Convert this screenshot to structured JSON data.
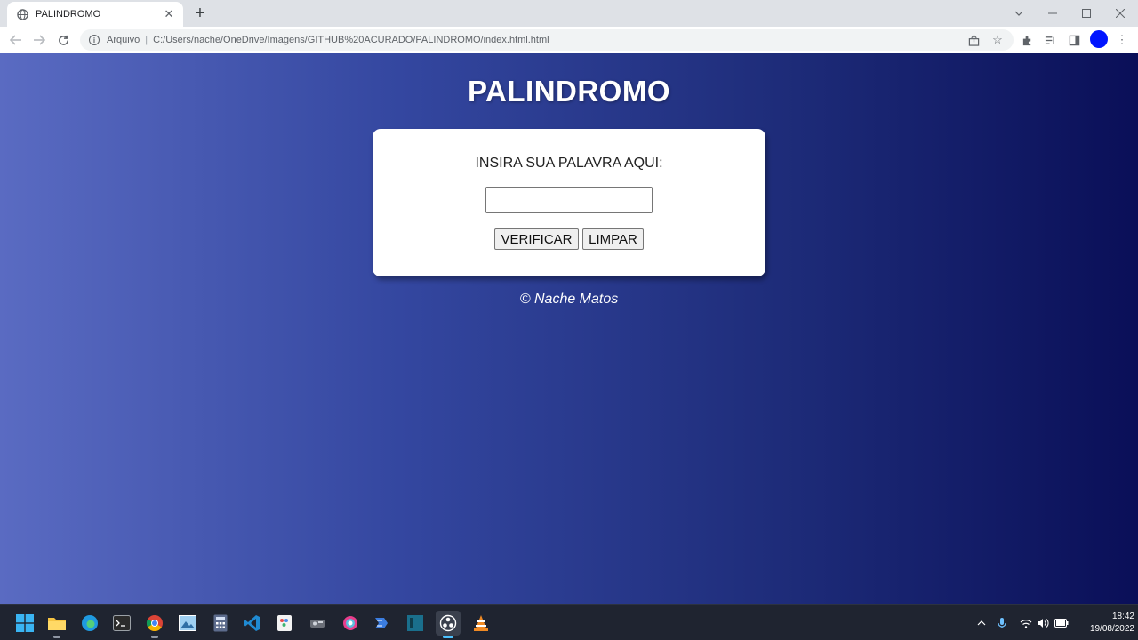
{
  "browser": {
    "tab_title": "PALINDROMO",
    "omnibox_label": "Arquivo",
    "omnibox_url": "C:/Users/nache/OneDrive/Imagens/GITHUB%20ACURADO/PALINDROMO/index.html.html"
  },
  "page": {
    "title": "PALINDROMO",
    "prompt": "INSIRA SUA PALAVRA AQUI:",
    "input_value": "",
    "verify_label": "VERIFICAR",
    "clear_label": "LIMPAR",
    "credit": "© Nache Matos"
  },
  "taskbar": {
    "time": "18:42",
    "date": "19/08/2022"
  },
  "colors": {
    "gradient_left": "#5a6bc2",
    "gradient_right": "#0a0f58",
    "card": "#ffffff",
    "profile": "#0014ff"
  }
}
